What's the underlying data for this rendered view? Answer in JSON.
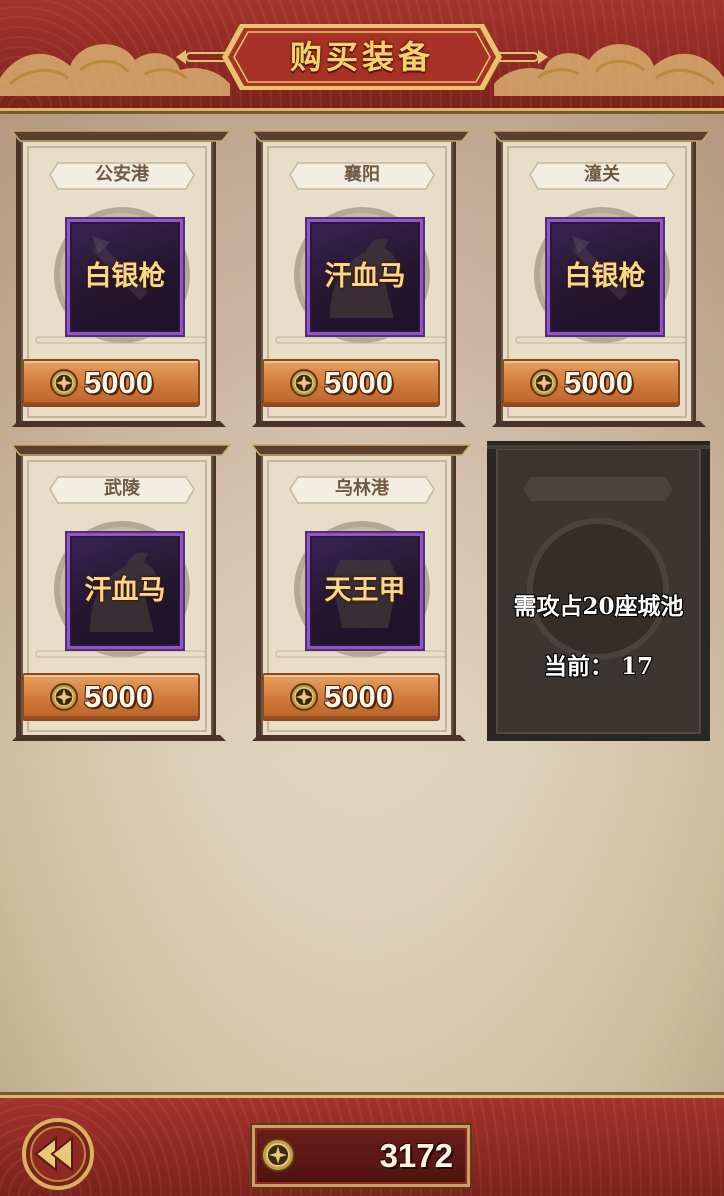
{
  "header": {
    "title": "购买装备"
  },
  "shop_items": [
    {
      "city": "公安港",
      "item": "白银枪",
      "price": "5000",
      "icon": "spear-silhouette"
    },
    {
      "city": "襄阳",
      "item": "汗血马",
      "price": "5000",
      "icon": "horse-silhouette"
    },
    {
      "city": "潼关",
      "item": "白银枪",
      "price": "5000",
      "icon": "spear-silhouette"
    },
    {
      "city": "武陵",
      "item": "汗血马",
      "price": "5000",
      "icon": "horse-silhouette"
    },
    {
      "city": "乌林港",
      "item": "天王甲",
      "price": "5000",
      "icon": "armor-silhouette"
    }
  ],
  "locked_slot": {
    "requirement": "需攻占20座城池",
    "current": "当前： 17"
  },
  "footer": {
    "currency": "3172",
    "back_icon": "back-arrow-icon",
    "coin_icon": "coin-icon"
  },
  "colors": {
    "header_red": "#a4342c",
    "title_gold": "#f4d46a",
    "item_purple": "#8f56c9",
    "price_orange": "#cf7a3b"
  }
}
